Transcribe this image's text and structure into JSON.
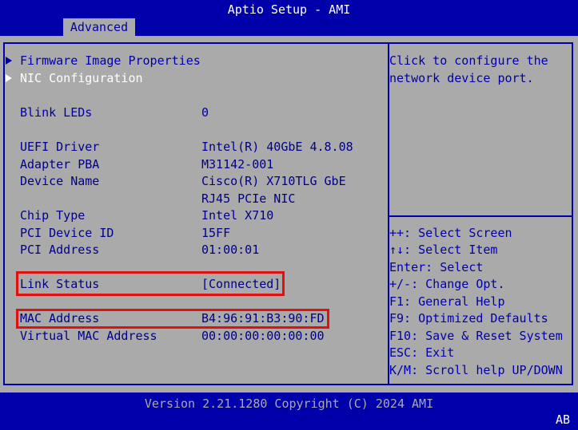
{
  "app": {
    "title": "Aptio Setup - AMI",
    "active_tab": "Advanced"
  },
  "menu": {
    "items": [
      {
        "label": "Firmware Image Properties",
        "selected": false
      },
      {
        "label": "NIC Configuration",
        "selected": true
      }
    ]
  },
  "blink": {
    "label": "Blink LEDs",
    "value": "0"
  },
  "info": [
    {
      "label": "UEFI Driver",
      "value": "Intel(R) 40GbE 4.8.08"
    },
    {
      "label": "Adapter PBA",
      "value": "M31142-001"
    },
    {
      "label": "Device Name",
      "value": "Cisco(R) X710TLG GbE",
      "value2": "RJ45 PCIe NIC"
    },
    {
      "label": "Chip Type",
      "value": "Intel X710"
    },
    {
      "label": "PCI Device ID",
      "value": "15FF"
    },
    {
      "label": "PCI Address",
      "value": "01:00:01"
    },
    {
      "label": "Link Status",
      "value": "[Connected]"
    },
    {
      "label": "MAC Address",
      "value": "B4:96:91:B3:90:FD"
    },
    {
      "label": "Virtual MAC Address",
      "value": "00:00:00:00:00:00"
    }
  ],
  "help": {
    "lines": [
      "Click to configure the",
      "network device port."
    ]
  },
  "keys": [
    "++: Select Screen",
    "↑↓: Select Item",
    "Enter: Select",
    "+/-: Change Opt.",
    "F1: General Help",
    "F9: Optimized Defaults",
    "F10: Save & Reset System",
    "ESC: Exit",
    "K/M: Scroll help UP/DOWN"
  ],
  "footer": {
    "version": "Version 2.21.1280 Copyright (C) 2024 AMI",
    "corner": "AB"
  },
  "colors": {
    "bios_blue": "#0000aa",
    "panel_gray": "#aaaaaa",
    "highlight_red": "#e01010"
  }
}
